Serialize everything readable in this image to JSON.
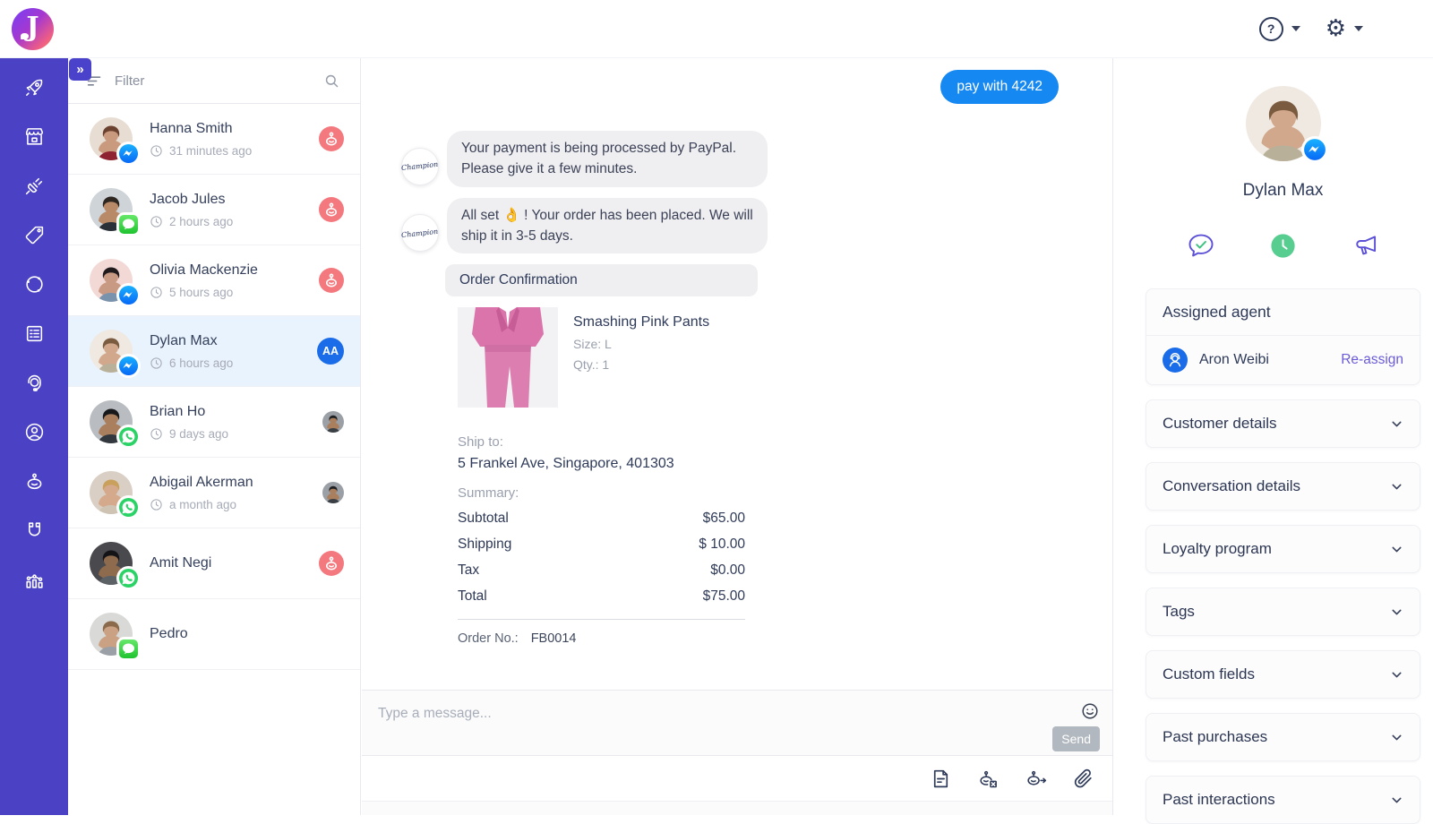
{
  "app": {
    "logo_letter": "J"
  },
  "topbar": {
    "help_glyph": "?",
    "settings_glyph": "⚙"
  },
  "rail": {
    "expand_glyph": "»",
    "icons": [
      "rocket",
      "store",
      "integrations",
      "tags",
      "network",
      "forms",
      "support",
      "contacts",
      "chatbot",
      "capture",
      "analytics"
    ]
  },
  "conversations": {
    "filter_label": "Filter",
    "items": [
      {
        "name": "Hanna Smith",
        "time": "31 minutes ago",
        "channel": "messenger",
        "indicator": "bot"
      },
      {
        "name": "Jacob Jules",
        "time": "2 hours ago",
        "channel": "imessage",
        "indicator": "bot"
      },
      {
        "name": "Olivia Mackenzie",
        "time": "5 hours ago",
        "channel": "messenger",
        "indicator": "bot"
      },
      {
        "name": "Dylan Max",
        "time": "6 hours ago",
        "channel": "messenger",
        "indicator": "initials",
        "initials": "AA",
        "selected": true
      },
      {
        "name": "Brian Ho",
        "time": "9 days ago",
        "channel": "whatsapp",
        "indicator": "avatar"
      },
      {
        "name": "Abigail Akerman",
        "time": "a month ago",
        "channel": "whatsapp",
        "indicator": "avatar"
      },
      {
        "name": "Amit Negi",
        "time": "",
        "channel": "whatsapp",
        "indicator": "bot"
      },
      {
        "name": "Pedro",
        "time": "",
        "channel": "imessage",
        "indicator": "none"
      }
    ]
  },
  "chat": {
    "outgoing_bubble": "pay with 4242",
    "messages": [
      {
        "sender": "Champion",
        "text": "Your payment is being processed by PayPal. Please give it a few minutes."
      },
      {
        "sender": "Champion",
        "text": "All set 👌 ! Your order has been placed. We will ship it in 3-5 days."
      }
    ],
    "order_card": {
      "title": "Order Confirmation",
      "product_name": "Smashing Pink Pants",
      "size_label": "Size: L",
      "qty_label": "Qty.: 1",
      "ship_to_label": "Ship to:",
      "ship_to_value": "5 Frankel Ave, Singapore, 401303",
      "summary_label": "Summary:",
      "rows": [
        {
          "label": "Subtotal",
          "value": "$65.00"
        },
        {
          "label": "Shipping",
          "value": "$ 10.00"
        },
        {
          "label": "Tax",
          "value": "$0.00"
        },
        {
          "label": "Total",
          "value": "$75.00"
        }
      ],
      "order_no_label": "Order No.:",
      "order_no_value": "FB0014"
    },
    "composer": {
      "placeholder": "Type a message...",
      "send_label": "Send"
    }
  },
  "details": {
    "customer_name": "Dylan Max",
    "assigned_agent": {
      "title": "Assigned agent",
      "agent_name": "Aron Weibi",
      "reassign_label": "Re-assign"
    },
    "sections": [
      "Customer details",
      "Conversation details",
      "Loyalty program",
      "Tags",
      "Custom fields",
      "Past purchases",
      "Past interactions"
    ]
  },
  "colors": {
    "rail_purple": "#4A41C4",
    "accent_purple": "#5B50D6",
    "selected_row_bg": "#E9F3FD",
    "bot_badge_red": "#F4797E",
    "outgoing_blue": "#1588F2",
    "messenger_blue": "#0768F6",
    "imessage_green": "#1FC32F",
    "whatsapp_green": "#2BD366",
    "initials_badge_blue": "#1B6CE8",
    "clock_green": "#57CD90",
    "send_button_gray": "#B2B8BF"
  }
}
